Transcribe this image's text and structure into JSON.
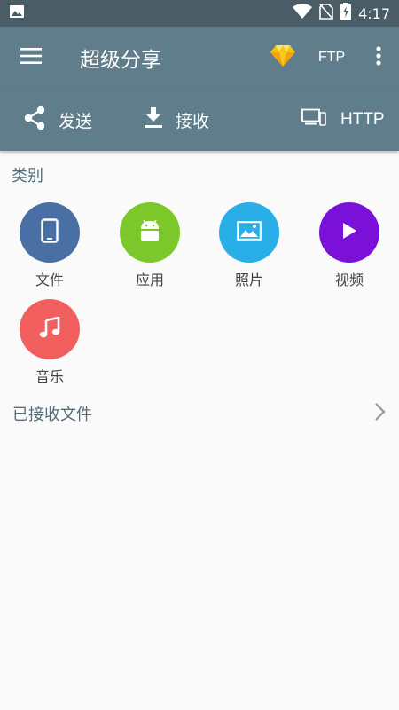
{
  "status_bar": {
    "time": "4:17",
    "icons": [
      "image-icon",
      "wifi-icon",
      "no-sim-icon",
      "battery-charging-icon"
    ]
  },
  "toolbar": {
    "title": "超级分享",
    "ftp_label": "FTP",
    "icons": [
      "menu-icon",
      "gem-icon",
      "more-vert-icon"
    ]
  },
  "actions": {
    "send_label": "发送",
    "receive_label": "接收",
    "http_label": "HTTP"
  },
  "categories_section": {
    "title": "类别",
    "items": [
      {
        "label": "文件",
        "icon": "phone-icon",
        "color": "#4a6fa5"
      },
      {
        "label": "应用",
        "icon": "android-icon",
        "color": "#7cc82a"
      },
      {
        "label": "照片",
        "icon": "photo-icon",
        "color": "#29aee8"
      },
      {
        "label": "视频",
        "icon": "play-icon",
        "color": "#7b11d8"
      },
      {
        "label": "音乐",
        "icon": "music-note-icon",
        "color": "#f25f5f"
      }
    ]
  },
  "received": {
    "label": "已接收文件",
    "icon": "chevron-right-icon"
  },
  "colors": {
    "status_bar": "#4a5d66",
    "toolbar": "#607d8b",
    "background": "#fafafa",
    "section_text": "#546e7a"
  }
}
